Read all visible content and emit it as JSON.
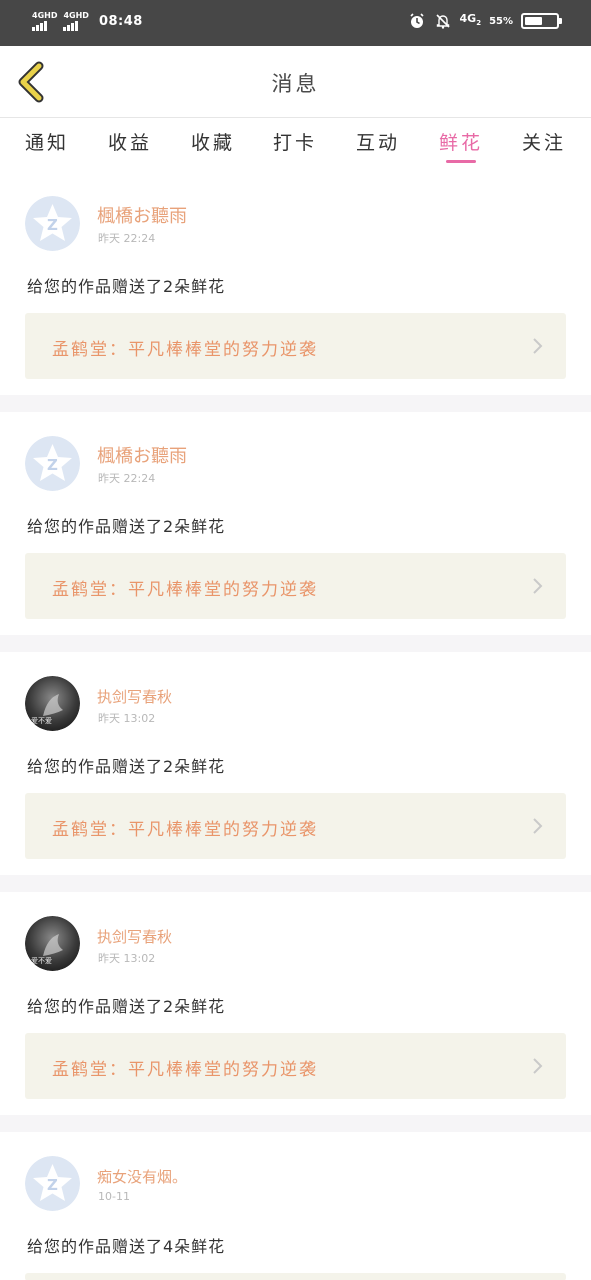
{
  "status_bar": {
    "signal1": "4GHD",
    "signal2": "4GHD",
    "time": "08:48",
    "network": "4G",
    "network_sub": "2",
    "battery": "55%",
    "battery_level": 0.55
  },
  "header": {
    "title": "消息",
    "back_icon": "chevron-left-icon"
  },
  "tabs": [
    {
      "label": "通知"
    },
    {
      "label": "收益"
    },
    {
      "label": "收藏"
    },
    {
      "label": "打卡"
    },
    {
      "label": "互动"
    },
    {
      "label": "鲜花",
      "active": true
    },
    {
      "label": "关注"
    }
  ],
  "messages": [
    {
      "user": "楓橋お聽雨",
      "time": "昨天 22:24",
      "text": "给您的作品赠送了2朵鲜花",
      "work": "孟鹤堂：平凡棒棒堂的努力逆袭",
      "avatar": "default-avatar"
    },
    {
      "user": "楓橋お聽雨",
      "time": "昨天 22:24",
      "text": "给您的作品赠送了2朵鲜花",
      "work": "孟鹤堂：平凡棒棒堂的努力逆袭",
      "avatar": "default-avatar"
    },
    {
      "user": "执剑写春秋",
      "time": "昨天 13:02",
      "text": "给您的作品赠送了2朵鲜花",
      "work": "孟鹤堂：平凡棒棒堂的努力逆袭",
      "avatar": "photo-avatar",
      "avatar_caption": "爱不爱"
    },
    {
      "user": "执剑写春秋",
      "time": "昨天 13:02",
      "text": "给您的作品赠送了2朵鲜花",
      "work": "孟鹤堂：平凡棒棒堂的努力逆袭",
      "avatar": "photo-avatar",
      "avatar_caption": "爱不爱"
    },
    {
      "user": "痴女没有烟。",
      "time": "10-11",
      "text": "给您的作品赠送了4朵鲜花",
      "avatar": "default-avatar"
    }
  ],
  "colors": {
    "accent_pink": "#e86aa6",
    "username": "#e8a27a",
    "work_text": "#e9956a",
    "work_bg": "#f4f3ea",
    "back_arrow": "#e9d24a"
  }
}
